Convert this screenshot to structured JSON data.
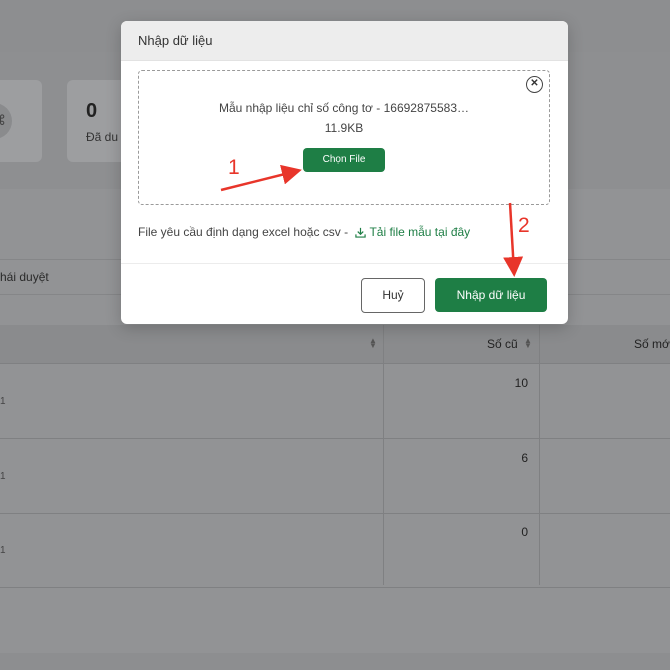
{
  "background": {
    "stat_card": {
      "value": "0",
      "label": "Đã du"
    },
    "filter_label": "hái duyệt",
    "table": {
      "columns": [
        "Số cũ",
        "Số mớ"
      ],
      "rows": [
        {
          "id": "1",
          "old_value": "10"
        },
        {
          "id": "1",
          "old_value": "6"
        },
        {
          "id": "1",
          "old_value": "0"
        }
      ]
    }
  },
  "modal": {
    "title": "Nhập dữ liệu",
    "file": {
      "name": "Mẫu nhập liệu chỉ số công tơ - 16692875583…",
      "size": "11.9KB"
    },
    "choose_file_label": "Chọn File",
    "hint_text": "File yêu cầu định dạng excel hoặc csv - ",
    "download_template_label": "Tải file mẫu tại đây",
    "cancel_label": "Huỷ",
    "import_label": "Nhập dữ liệu",
    "remove_icon": "close-circle-icon",
    "download_icon": "download-icon",
    "colors": {
      "primary": "#1e7e45",
      "annotation": "#e8352a"
    }
  },
  "annotations": {
    "step1": "1",
    "step2": "2"
  }
}
